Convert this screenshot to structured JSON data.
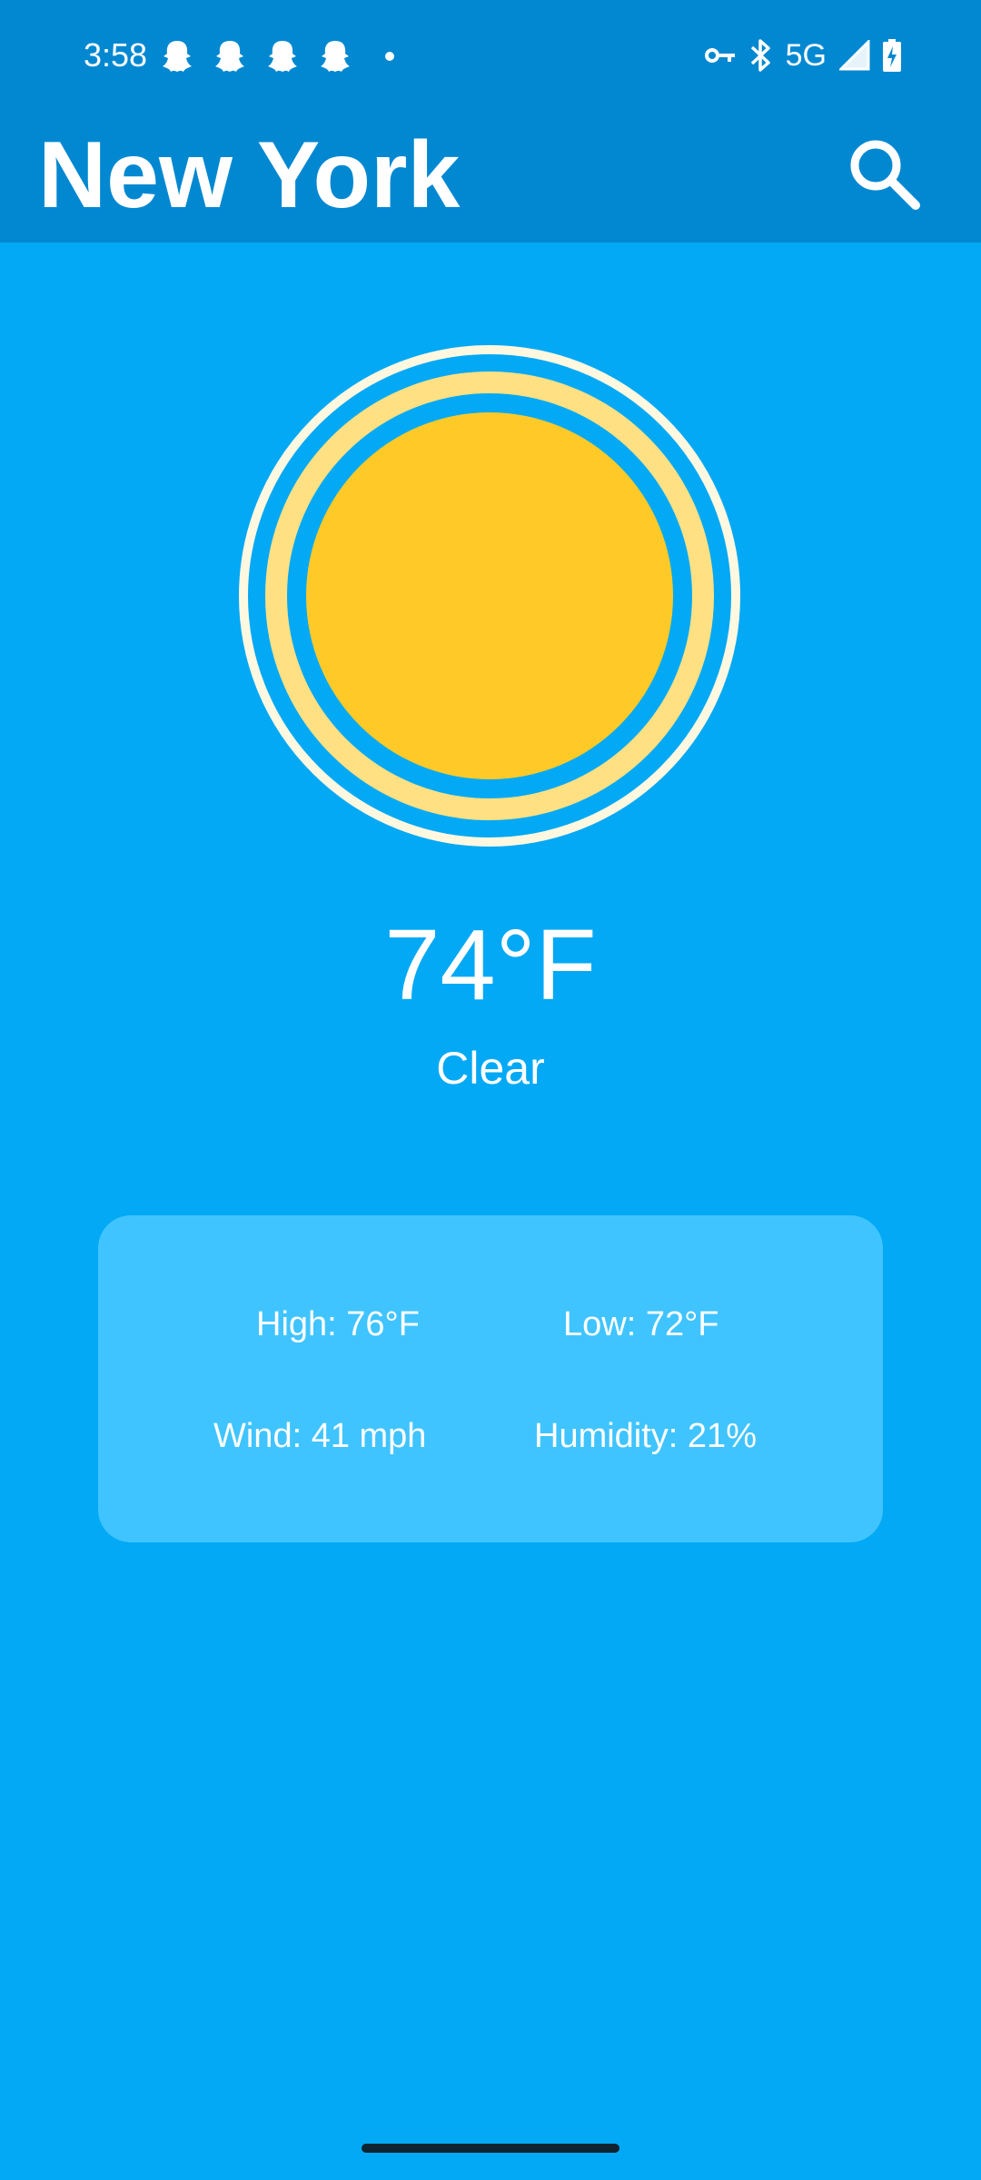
{
  "status_bar": {
    "time": "3:58",
    "network": "5G",
    "notification_icons": [
      "snapchat-icon",
      "snapchat-icon",
      "snapchat-icon",
      "snapchat-icon",
      "dot-icon"
    ],
    "system_icons": [
      "vpn-key-icon",
      "bluetooth-icon",
      "signal-icon",
      "battery-charging-icon"
    ]
  },
  "app_bar": {
    "title": "New York",
    "search_icon": "search-icon"
  },
  "weather": {
    "icon": "sun-icon",
    "temperature": "74°F",
    "condition": "Clear"
  },
  "details": {
    "high": "High: 76°F",
    "low": "Low: 72°F",
    "wind": "Wind: 41 mph",
    "humidity": "Humidity: 21%"
  },
  "colors": {
    "background": "#03A9F4",
    "app_bar": "#0288D1",
    "card": "#40C4FF",
    "sun": "#FFCA28",
    "sun_ring": "#FFE082",
    "sun_outer_ring": "#FFF8E1",
    "text": "#FFFFFF"
  }
}
